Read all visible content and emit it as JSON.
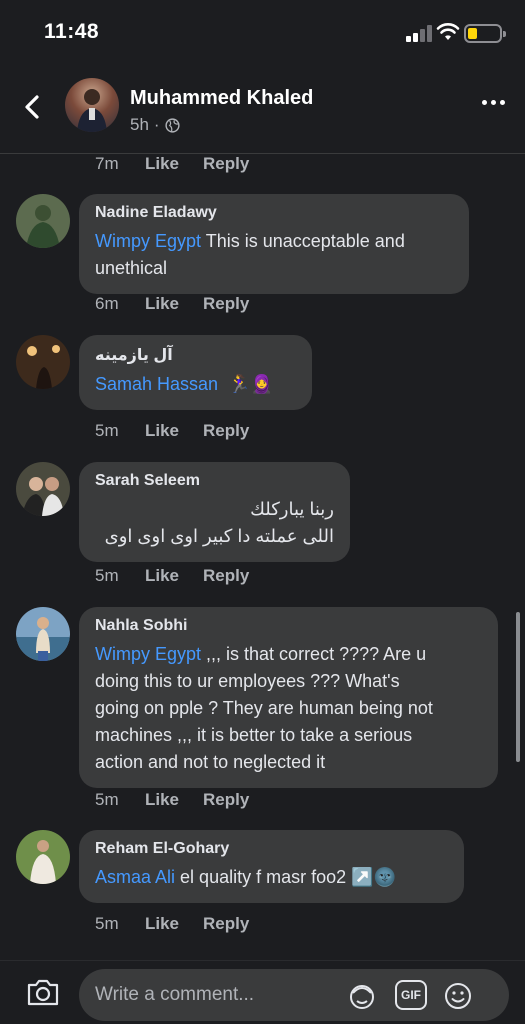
{
  "status_bar": {
    "time": "11:48"
  },
  "header": {
    "name": "Muhammed Khaled",
    "time": "5h",
    "separator": "·"
  },
  "top_actions": {
    "time": "7m",
    "like": "Like",
    "reply": "Reply"
  },
  "comments": [
    {
      "author": "Nadine Eladawy",
      "mention": "Wimpy Egypt",
      "text_line1": " This is unacceptable and",
      "text_line2": "unethical",
      "time": "6m",
      "like": "Like",
      "reply": "Reply"
    },
    {
      "author": "آل يازمينه",
      "mention": "Samah Hassan",
      "text": "",
      "emoji": "🏃‍♀️🧕",
      "time": "5m",
      "like": "Like",
      "reply": "Reply"
    },
    {
      "author": "Sarah Seleem",
      "text_line1": "ربنا يباركلك",
      "text_line2": "اللى عملته دا كبير اوى اوى اوى",
      "time": "5m",
      "like": "Like",
      "reply": "Reply"
    },
    {
      "author": "Nahla Sobhi",
      "mention": "Wimpy Egypt",
      "text_line1": " ,,, is that correct ???? Are u",
      "text_line2": "doing this to ur employees ??? What's",
      "text_line3": "going on pple ? They are human being not",
      "text_line4": "machines ,,, it is better to take a serious",
      "text_line5": "action and not to neglected it",
      "time": "5m",
      "like": "Like",
      "reply": "Reply"
    },
    {
      "author": "Reham El-Gohary",
      "mention": "Asmaa Ali",
      "text": "  el quality f masr foo2 ",
      "emoji": "↗️🌚",
      "time": "5m",
      "like": "Like",
      "reply": "Reply"
    }
  ],
  "composer": {
    "placeholder": "Write a comment...",
    "gif_label": "GIF"
  }
}
